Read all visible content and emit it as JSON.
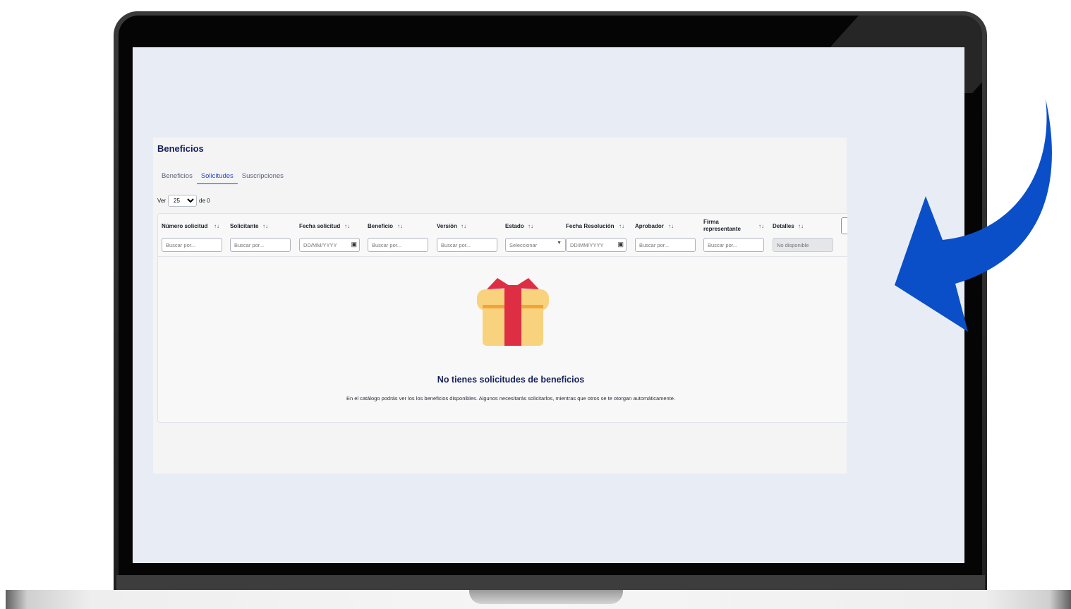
{
  "app": {
    "page_title": "Beneficios",
    "tabs": [
      {
        "label": "Beneficios",
        "active": false
      },
      {
        "label": "Solicitudes",
        "active": true
      },
      {
        "label": "Suscripciones",
        "active": false
      }
    ],
    "pager": {
      "prefix": "Ver",
      "page_size": "25",
      "suffix": "de 0"
    }
  },
  "table": {
    "columns": [
      {
        "label": "Número solicitud",
        "filter_placeholder": "Buscar por...",
        "filter_type": "text"
      },
      {
        "label": "Solicitante",
        "filter_placeholder": "Buscar por...",
        "filter_type": "text"
      },
      {
        "label": "Fecha solicitud",
        "filter_placeholder": "DD/MM/YYYY",
        "filter_type": "date"
      },
      {
        "label": "Beneficio",
        "filter_placeholder": "Buscar por...",
        "filter_type": "text"
      },
      {
        "label": "Versión",
        "filter_placeholder": "Buscar por...",
        "filter_type": "text"
      },
      {
        "label": "Estado",
        "filter_placeholder": "Seleccionar",
        "filter_type": "select"
      },
      {
        "label": "Fecha Resolución",
        "filter_placeholder": "DD/MM/YYYY",
        "filter_type": "date"
      },
      {
        "label": "Aprobador",
        "filter_placeholder": "Buscar por...",
        "filter_type": "text"
      },
      {
        "label": "Firma representante",
        "filter_placeholder": "Buscar por...",
        "filter_type": "text"
      },
      {
        "label": "Detalles",
        "filter_placeholder": "No disponible",
        "filter_type": "disabled"
      }
    ],
    "sort_icon": "↑↓"
  },
  "empty_state": {
    "icon": "gift-icon",
    "title": "No tienes solicitudes de beneficios",
    "text": "En el catálogo podrás ver los los beneficios disponibles. Algunos necesitarás solicitarlos, mientras que otros se te otorgan automáticamente."
  },
  "colors": {
    "accent": "#2b44c8",
    "title": "#16215a",
    "arrow": "#0a4fc8",
    "gift_box": "#f8d27c",
    "gift_ribbon": "#dd2e44"
  }
}
